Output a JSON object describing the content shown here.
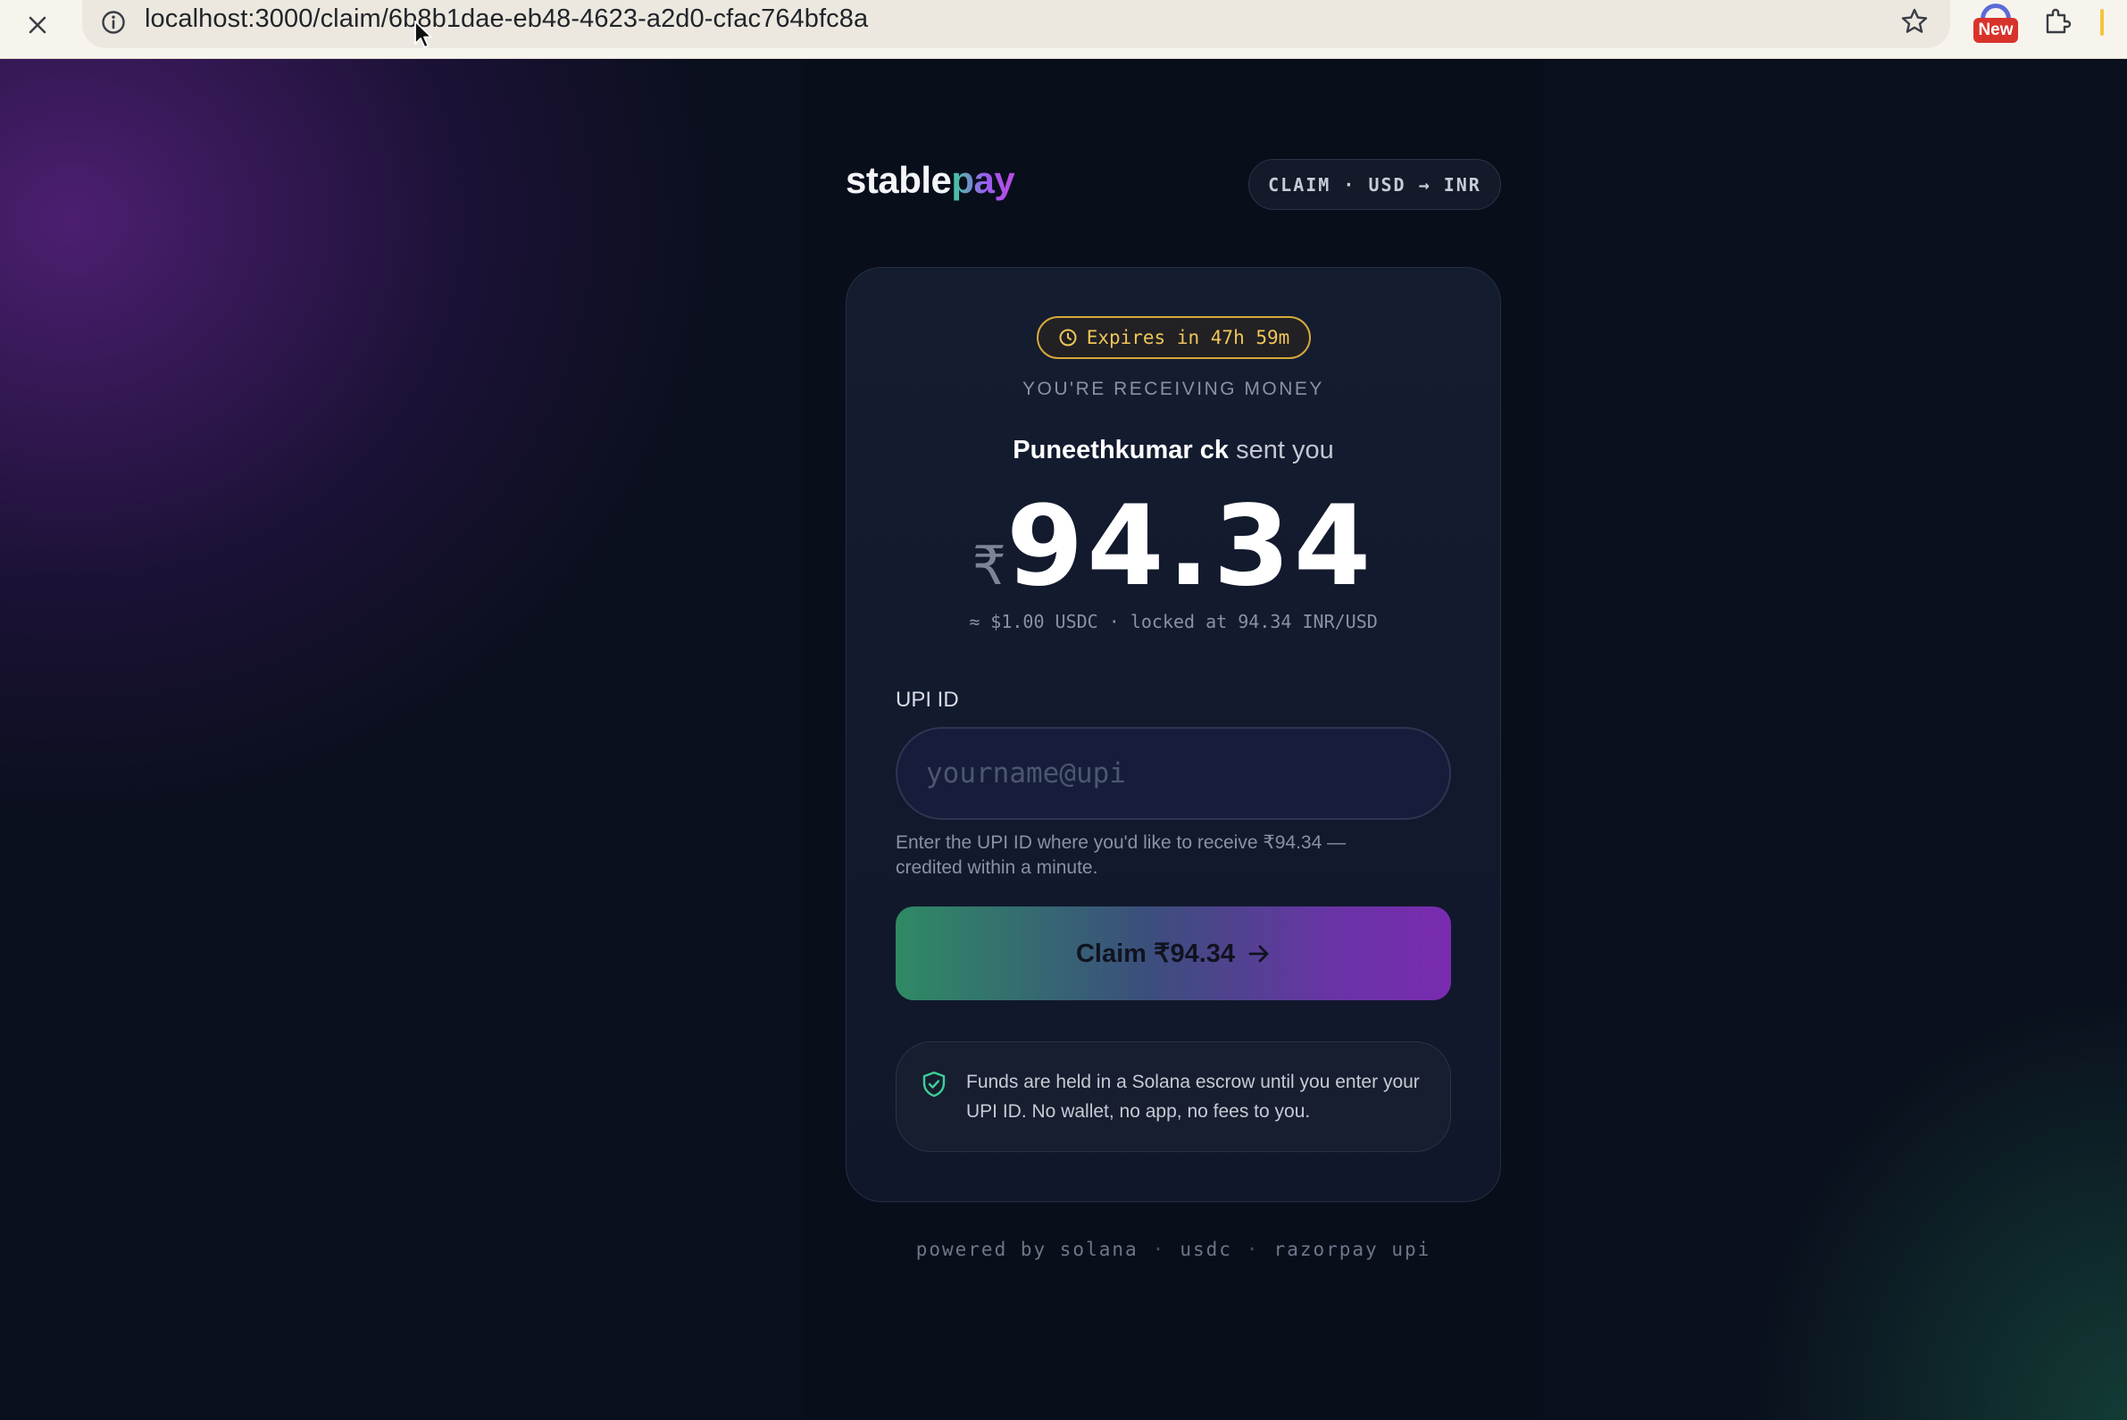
{
  "browser": {
    "url": "localhost:3000/claim/6b8b1dae-eb48-4623-a2d0-cfac764bfc8a",
    "extension_badge": "New"
  },
  "header": {
    "logo_stable": "stable",
    "logo_pay": "pay",
    "mode_pill": "CLAIM · USD → INR"
  },
  "card": {
    "expires": "Expires in 47h 59m",
    "eyebrow": "YOU'RE RECEIVING MONEY",
    "sender_name": "Puneethkumar ck",
    "sender_suffix": " sent you",
    "currency_symbol": "₹",
    "amount": "94.34",
    "rate_line": "≈ $1.00 USDC · locked at 94.34 INR/USD",
    "upi_label": "UPI ID",
    "upi_value": "",
    "upi_placeholder": "yourname@upi",
    "helper_text": "Enter the UPI ID where you'd like to receive ₹94.34 — credited within a minute.",
    "claim_button": "Claim ₹94.34",
    "escrow_note": "Funds are held in a Solana escrow until you enter your UPI ID. No wallet, no app, no fees to you."
  },
  "footer": {
    "items": [
      "powered by solana",
      "usdc",
      "razorpay upi"
    ],
    "separator": "·"
  },
  "colors": {
    "background": "#0a0f1d",
    "card": "#141c30",
    "expires_accent": "#d7a93a",
    "logo_gradient_start": "#3ecf9a",
    "logo_gradient_end": "#b94be0",
    "button_gradient_start": "#2f8a64",
    "button_gradient_end": "#7a2bb0",
    "shield": "#3ecf9a"
  },
  "icons": {
    "close": "close-icon",
    "info": "info-icon",
    "star": "star-icon",
    "puzzle": "puzzle-icon",
    "clock": "clock-icon",
    "arrow": "arrow-right-icon",
    "shield": "shield-check-icon"
  }
}
